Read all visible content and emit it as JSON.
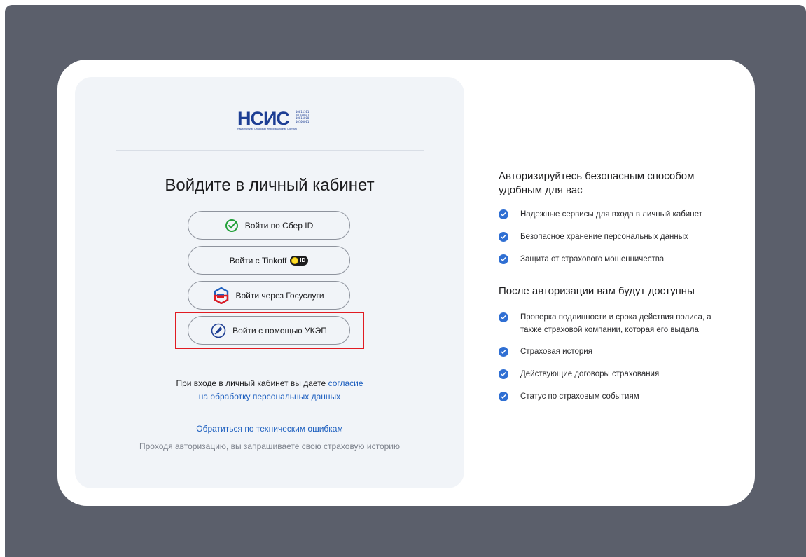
{
  "logo": {
    "brand": "НСИС",
    "bits": [
      "10011101",
      "10100001",
      "10011000",
      "10100001"
    ],
    "subtitle": "Национальная Страховая Информационная Система"
  },
  "login": {
    "title": "Войдите в личный кабинет",
    "sber_label": "Войти по Сбер ID",
    "tinkoff_label": "Войти с Tinkoff",
    "tinkoff_badge": "ID",
    "gosuslugi_label": "Войти через Госуслуги",
    "ukep_label": "Войти с помощью УКЭП",
    "consent_text": "При входе в личный кабинет вы даете",
    "consent_link_1": "согласие",
    "consent_link_2": "на обработку персональных данных",
    "tech_link": "Обратиться по техническим ошибкам",
    "note": "Проходя авторизацию, вы запрашиваете свою страховую историю"
  },
  "info": {
    "heading_1": "Авторизируйтесь безопасным способом удобным для вас",
    "features_1": [
      "Надежные сервисы для входа в личный кабинет",
      "Безопасное хранение персональных данных",
      "Защита от страхового мошенничества"
    ],
    "heading_2": "После авторизации вам будут доступны",
    "features_2": [
      "Проверка подлинности и срока действия полиса, а также страховой компании, которая его выдала",
      "Страховая история",
      "Действующие договоры страхования",
      "Статус по страховым событиям"
    ]
  },
  "colors": {
    "brand_blue": "#1d3e94",
    "link_blue": "#1d5fbf",
    "check_blue": "#2f6fd3",
    "highlight_red": "#e11b22",
    "sber_green": "#21a038"
  }
}
